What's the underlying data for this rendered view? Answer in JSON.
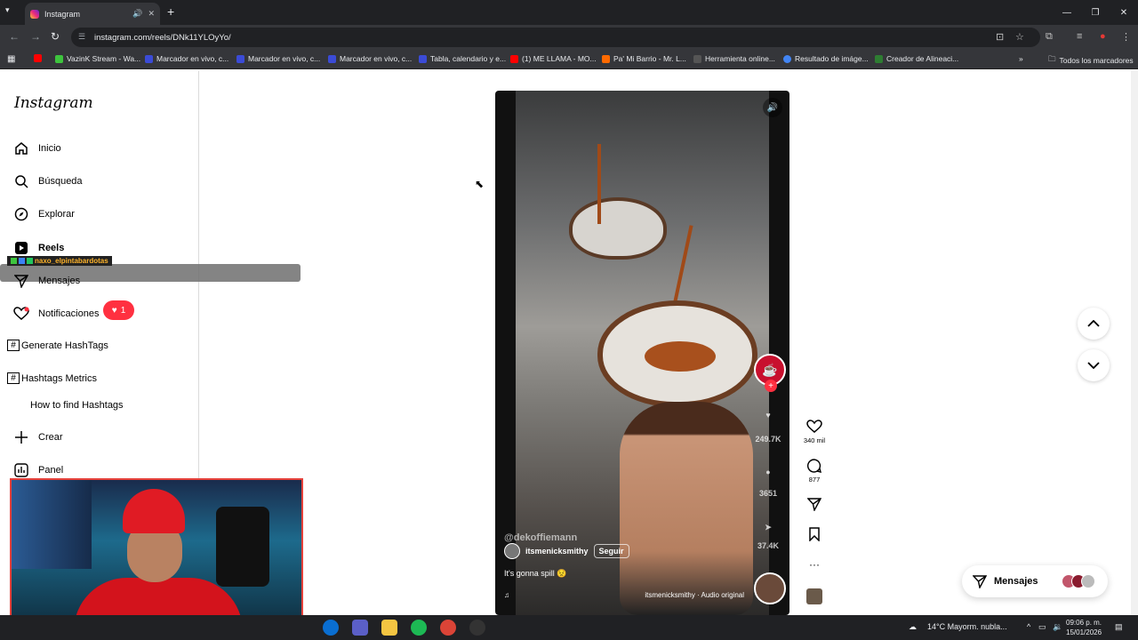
{
  "browser": {
    "tab_title": "Instagram",
    "url": "instagram.com/reels/DNk11YLOyYo/",
    "bookmarks": [
      {
        "label": "VazinK Stream - Wa...",
        "color": "#3ec43e"
      },
      {
        "label": "Marcador en vivo, c...",
        "color": "#3b4bd6"
      },
      {
        "label": "Marcador en vivo, c...",
        "color": "#3b4bd6"
      },
      {
        "label": "Marcador en vivo, c...",
        "color": "#3b4bd6"
      },
      {
        "label": "Tabla, calendario y e...",
        "color": "#3b4bd6"
      },
      {
        "label": "(1) ME LLAMA - MO...",
        "color": "#ff0000"
      },
      {
        "label": "Pa' Mi Barrio - Mr. L...",
        "color": "#ff6a00"
      },
      {
        "label": "Herramienta online...",
        "color": "#555555"
      },
      {
        "label": "Resultado de imáge...",
        "color": "#4285f4"
      },
      {
        "label": "Creador de Alineaci...",
        "color": "#2e7d32"
      }
    ],
    "all_bookmarks": "Todos los marcadores"
  },
  "sidebar": {
    "logo": "Instagram",
    "items": [
      {
        "label": "Inicio",
        "icon": "home-icon"
      },
      {
        "label": "Búsqueda",
        "icon": "search-icon"
      },
      {
        "label": "Explorar",
        "icon": "compass-icon"
      },
      {
        "label": "Reels",
        "icon": "reels-icon"
      },
      {
        "label": "Mensajes",
        "icon": "send-icon"
      },
      {
        "label": "Notificaciones",
        "icon": "heart-icon"
      },
      {
        "label": "Generate HashTags",
        "icon": "hash-icon"
      },
      {
        "label": "Hashtags Metrics",
        "icon": "hash-icon"
      },
      {
        "label": "How to find Hashtags",
        "icon": ""
      },
      {
        "label": "Crear",
        "icon": "plus-icon"
      },
      {
        "label": "Panel",
        "icon": "chart-icon"
      }
    ],
    "notification_count": "1"
  },
  "overlay": {
    "username": "naxo_elpintabardotas"
  },
  "reel": {
    "watermark": "@dekoffiemann",
    "author": "itsmenicksmithy",
    "follow_label": "Seguir",
    "caption": "It's gonna spill 😟",
    "audio": "itsmenicksmithy · Audio original",
    "ghost_likes": "249.7K",
    "ghost_comments": "3651",
    "ghost_shares": "37.4K"
  },
  "actions": {
    "likes": "340 mil",
    "comments": "877"
  },
  "messages_pill": {
    "label": "Mensajes"
  },
  "taskbar": {
    "weather": "14°C  Mayorm. nubla...",
    "time": "09:06 p. m.",
    "date": "15/01/2026"
  }
}
